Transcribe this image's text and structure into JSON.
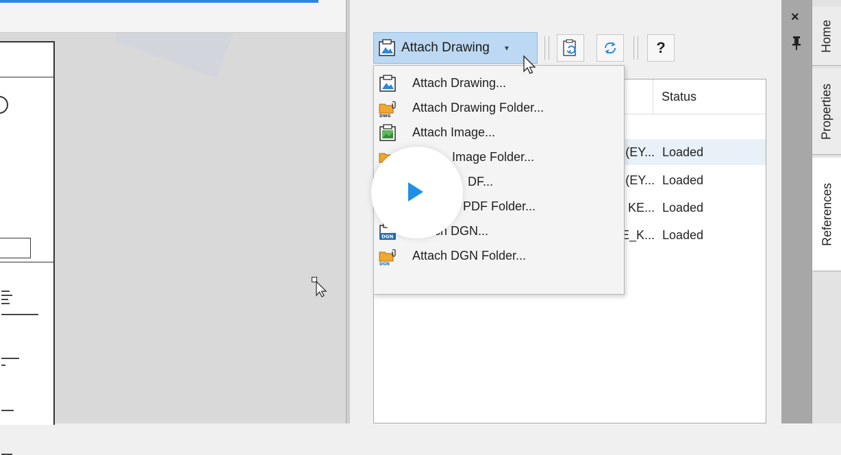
{
  "toolbar": {
    "attach_drawing_label": "Attach Drawing",
    "help_label": "?"
  },
  "dropdown": {
    "items": [
      {
        "label": "Attach Drawing...",
        "icon": "attach-drawing-icon"
      },
      {
        "label": "Attach Drawing Folder...",
        "icon": "attach-drawing-folder-icon"
      },
      {
        "label": "Attach Image...",
        "icon": "attach-image-icon"
      },
      {
        "label": "Image Folder...",
        "icon": "attach-image-folder-icon"
      },
      {
        "label": "DF...",
        "icon": "attach-pdf-icon"
      },
      {
        "label": "PDF Folder...",
        "icon": "attach-pdf-folder-icon"
      },
      {
        "label": "Attach DGN...",
        "icon": "attach-dgn-icon"
      },
      {
        "label": "Attach DGN Folder...",
        "icon": "attach-dgn-folder-icon"
      }
    ]
  },
  "references": {
    "status_header": "Status",
    "rows": [
      {
        "name": "(EY...",
        "status": "Loaded"
      },
      {
        "name": "(EY...",
        "status": "Loaded"
      },
      {
        "name": "KE...",
        "status": "Loaded"
      },
      {
        "name": "E_K...",
        "status": "Loaded"
      }
    ]
  },
  "side_tabs": {
    "home": "Home",
    "properties": "Properties",
    "references": "References"
  },
  "panel_controls": {
    "close": "×"
  },
  "colors": {
    "accent_blue": "#2e86de",
    "button_selected": "#bcd8f2",
    "play_blue": "#1e8fe6"
  }
}
